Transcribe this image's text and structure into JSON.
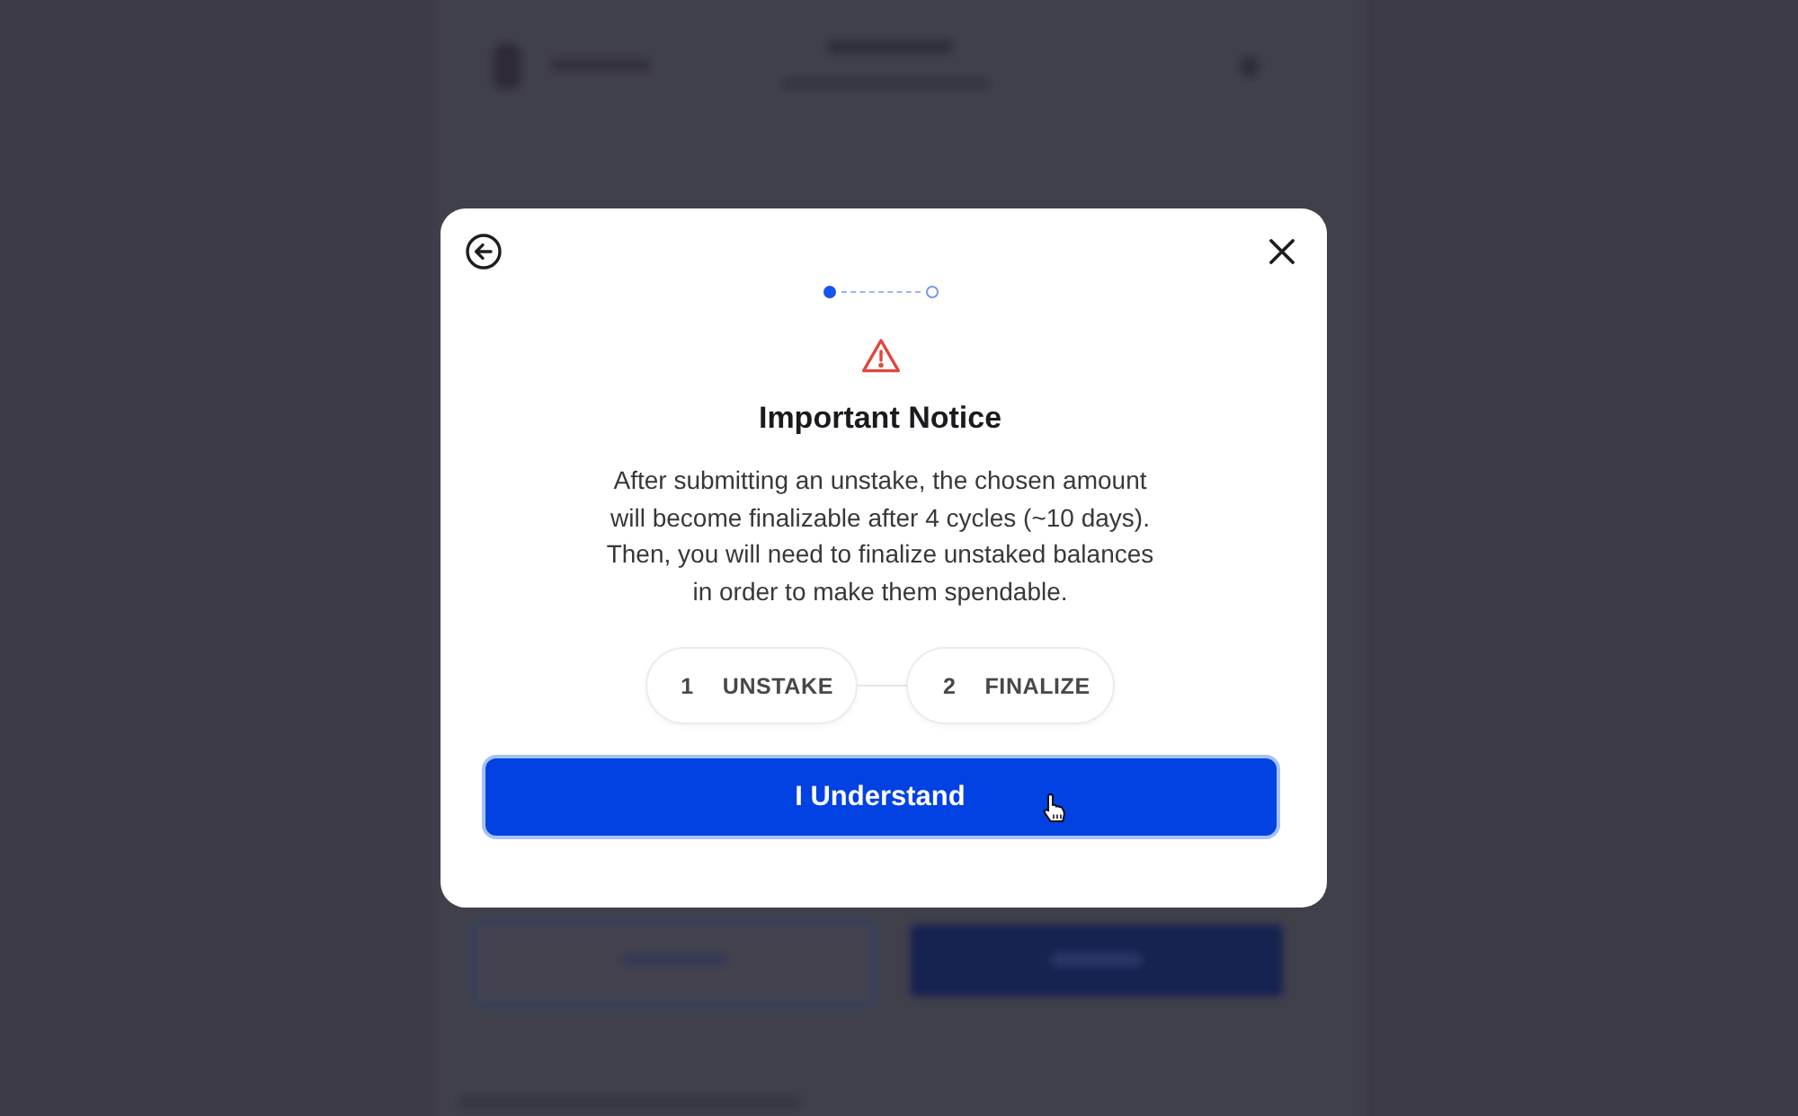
{
  "dialog": {
    "progress_steps": [
      {
        "active": true
      },
      {
        "active": false
      }
    ],
    "title": "Important Notice",
    "message": "After submitting an unstake, the chosen amount will become finalizable after 4 cycles (~10 days). Then, you will need to finalize unstaked balances in order to make them spendable.",
    "steps": [
      {
        "number": "1",
        "label": "UNSTAKE"
      },
      {
        "number": "2",
        "label": "FINALIZE"
      }
    ],
    "confirm_button": "I Understand"
  }
}
